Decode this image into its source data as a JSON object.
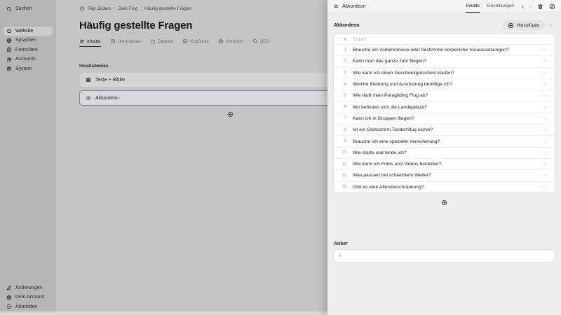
{
  "colors": {
    "selected_border": "#6d87a7",
    "panel_bg": "#eeeeee",
    "dim_bg": "#c5c5c5",
    "sidebar_bg": "#b5b5b5"
  },
  "sidebar": {
    "search": {
      "label": "Suchen",
      "icon": "search-icon"
    },
    "nav": [
      {
        "label": "Website",
        "icon": "home-icon",
        "active": true
      },
      {
        "label": "Sprachen",
        "icon": "languages-icon"
      },
      {
        "label": "Formulare",
        "icon": "form-icon"
      },
      {
        "label": "Accounts",
        "icon": "accounts-icon"
      },
      {
        "label": "System",
        "icon": "system-sliders-icon"
      }
    ],
    "footer": [
      {
        "label": "Änderungen",
        "icon": "pencil-icon"
      },
      {
        "label": "Dein Account",
        "icon": "user-circle-icon"
      },
      {
        "label": "Abmelden",
        "icon": "logout-icon"
      }
    ]
  },
  "breadcrumb": {
    "separator": "/",
    "items": [
      {
        "label": "Rigi Gliders"
      },
      {
        "label": "Dein Flug"
      },
      {
        "label": "Häufig gestellte Fragen"
      }
    ]
  },
  "page": {
    "title": "Häufig gestellte Fragen",
    "tabs": [
      {
        "label": "Inhalte",
        "icon": "content-lines-icon",
        "active": true
      },
      {
        "label": "Unterseiten",
        "icon": "subpages-icon"
      },
      {
        "label": "Dateien",
        "icon": "files-icon"
      },
      {
        "label": "Kopfzeile",
        "icon": "header-image-icon"
      },
      {
        "label": "Anreißer",
        "icon": "teaser-icon"
      },
      {
        "label": "SEO",
        "icon": "seo-icon"
      }
    ]
  },
  "content_blocks": {
    "label": "Inhaltsblöcke",
    "blocks": [
      {
        "label": "Texte + Bilder",
        "icon": "text-image-icon"
      },
      {
        "label": "Akkordeon",
        "icon": "accordion-list-icon",
        "selected": true
      }
    ]
  },
  "panel": {
    "header": {
      "title": "Akkordeon",
      "tabs": [
        {
          "label": "Inhalte",
          "active": true
        },
        {
          "label": "Einstellungen"
        }
      ],
      "prev": "‹",
      "next": "›"
    },
    "section": {
      "label": "Akkordeon",
      "add_label": "Hinzufügen",
      "more_label": "···"
    },
    "table": {
      "columns": {
        "num": "#",
        "title": "Titel"
      },
      "row_more": "···",
      "rows": [
        {
          "n": "1",
          "title": "Brauche ich Vorkenntnisse oder bestimmte körperliche Voraussetzungen?"
        },
        {
          "n": "2",
          "title": "Kann man das ganze Jahr fliegen?"
        },
        {
          "n": "3",
          "title": "Wie kann ich einen Geschenkgutschein kaufen?"
        },
        {
          "n": "4",
          "title": "Welche Kleidung und Ausrüstung benötige ich?"
        },
        {
          "n": "5",
          "title": "Wie läuft mein Paragliding Flug ab?"
        },
        {
          "n": "6",
          "title": "Wo befinden sich die Landeplätze?"
        },
        {
          "n": "7",
          "title": "Kann ich in Gruppen fliegen?"
        },
        {
          "n": "8",
          "title": "Ist ein Gleitschirm Tandemflug sicher?"
        },
        {
          "n": "9",
          "title": "Brauche ich eine spezielle Versicherung?"
        },
        {
          "n": "10",
          "title": "Wie starte und lande ich?"
        },
        {
          "n": "11",
          "title": "Wie kann ich Fotos und Videos bestellen?"
        },
        {
          "n": "12",
          "title": "Was passiert bei schlechtem Wetter?"
        },
        {
          "n": "13",
          "title": "Gibt es eine Altersbeschränkung?"
        }
      ]
    },
    "anchor": {
      "label": "Anker",
      "placeholder": "#"
    }
  }
}
